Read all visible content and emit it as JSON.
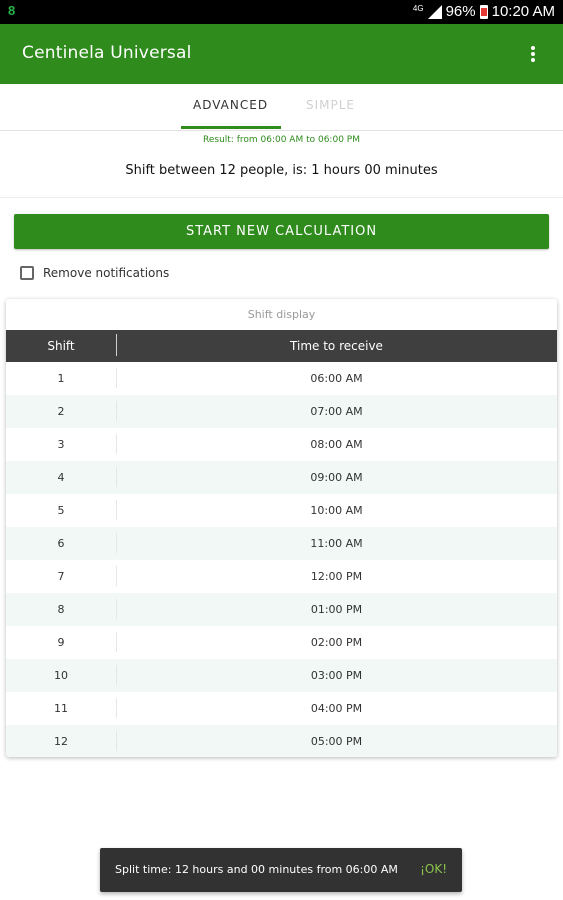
{
  "status_bar": {
    "notification_icon": "green-app-icon",
    "network": "4G",
    "battery": "96%",
    "time": "10:20 AM"
  },
  "app_bar": {
    "title": "Centinela Universal",
    "menu_icon": "more-vert-icon"
  },
  "tabs": [
    {
      "label": "ADVANCED",
      "active": true
    },
    {
      "label": "SIMPLE",
      "active": false
    }
  ],
  "result_text": "Result: from 06:00 AM to 06:00 PM",
  "shift_summary": "Shift between 12 people, is: 1 hours 00 minutes",
  "start_button_label": "START NEW CALCULATION",
  "remove_notifications_label": "Remove notifications",
  "shift_table": {
    "title": "Shift display",
    "headers": [
      "Shift",
      "Time to receive"
    ],
    "rows": [
      [
        "1",
        "06:00 AM"
      ],
      [
        "2",
        "07:00 AM"
      ],
      [
        "3",
        "08:00 AM"
      ],
      [
        "4",
        "09:00 AM"
      ],
      [
        "5",
        "10:00 AM"
      ],
      [
        "6",
        "11:00 AM"
      ],
      [
        "7",
        "12:00 PM"
      ],
      [
        "8",
        "01:00 PM"
      ],
      [
        "9",
        "02:00 PM"
      ],
      [
        "10",
        "03:00 PM"
      ],
      [
        "11",
        "04:00 PM"
      ],
      [
        "12",
        "05:00 PM"
      ]
    ]
  },
  "snackbar": {
    "message": "Split time: 12 hours and 00 minutes from 06:00 AM",
    "action": "¡OK!"
  },
  "colors": {
    "primary": "#2e8b1c",
    "table_header": "#3f3f3f",
    "row_alt": "#f1f8f5",
    "snackbar_action": "#8bc34a"
  }
}
